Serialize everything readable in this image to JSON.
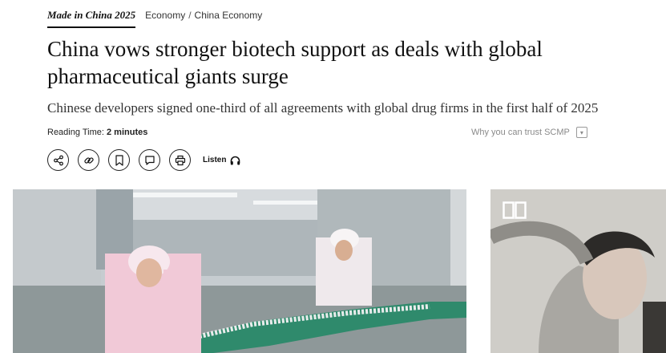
{
  "breadcrumb": {
    "section_tag": "Made in China 2025",
    "category": "Economy",
    "separator": "/",
    "subcategory": "China Economy"
  },
  "article": {
    "headline": "China vows stronger biotech support as deals with global pharmaceutical giants surge",
    "subheadline": "Chinese developers signed one-third of all agreements with global drug firms in the first half of 2025",
    "reading_time_label": "Reading Time:",
    "reading_time_value": "2 minutes"
  },
  "trust": {
    "label": "Why you can trust SCMP",
    "icon": "info-box-icon"
  },
  "toolbar": {
    "buttons": [
      {
        "name": "share",
        "icon": "share-icon"
      },
      {
        "name": "copy-link",
        "icon": "link-icon"
      },
      {
        "name": "bookmark",
        "icon": "bookmark-icon"
      },
      {
        "name": "comment",
        "icon": "comment-icon"
      },
      {
        "name": "print",
        "icon": "print-icon"
      }
    ],
    "listen_label": "Listen",
    "listen_icon": "headphones-icon"
  },
  "hero_image": {
    "subject": "photo-factory-workers-production-line"
  },
  "side_ad": {
    "subject": "photo-portrait-model",
    "icon": "book-icon"
  },
  "colors": {
    "text": "#111111",
    "muted": "#8a8a8a",
    "background": "#ffffff"
  }
}
